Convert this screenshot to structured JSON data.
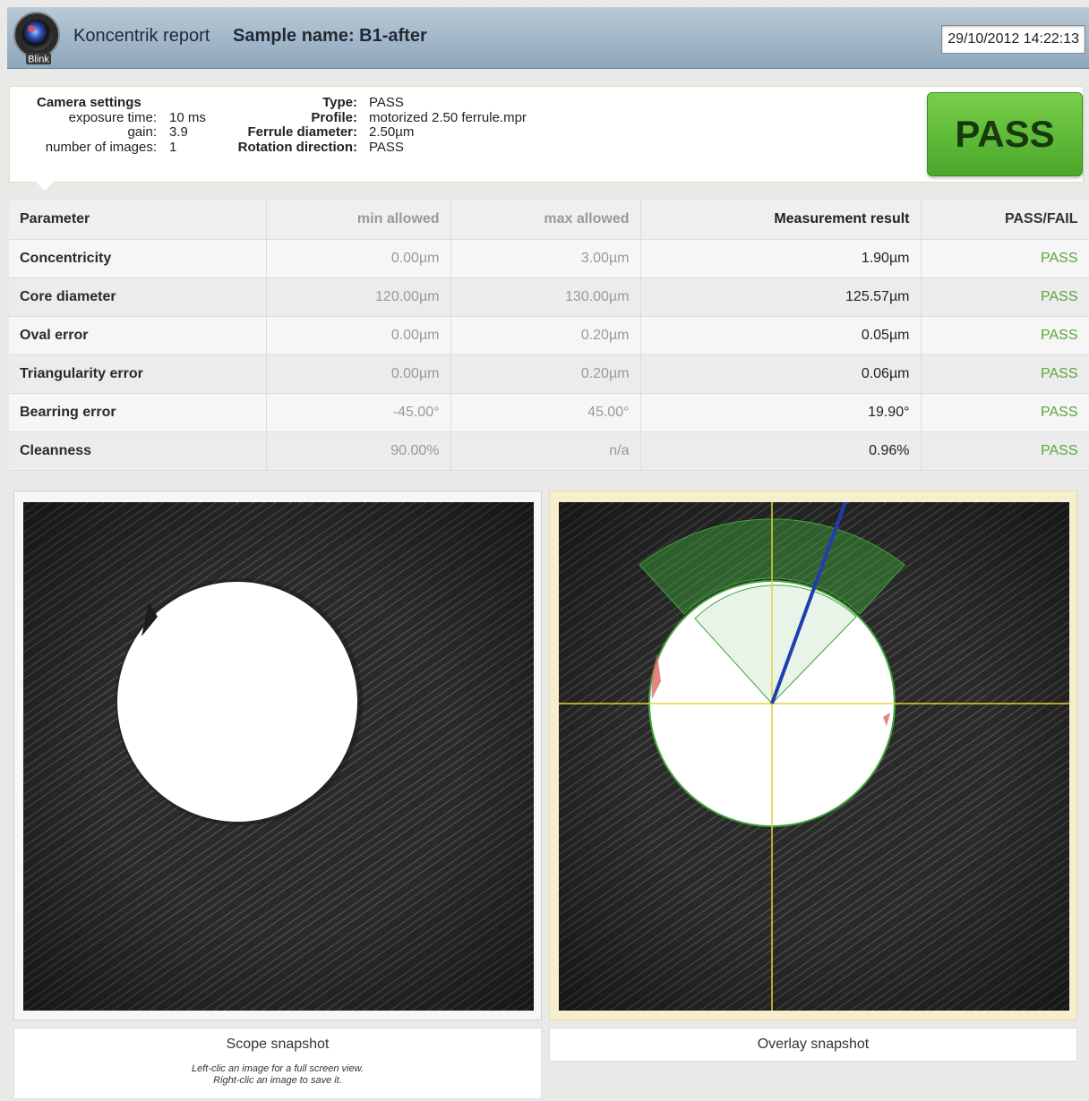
{
  "header": {
    "logo_text": "Blink",
    "app_title": "Koncentrik report",
    "sample_name": "Sample name: B1-after",
    "timestamp": "29/10/2012 14:22:13"
  },
  "camera_settings": {
    "title": "Camera settings",
    "rows": [
      {
        "label": "exposure time:",
        "value": "10 ms"
      },
      {
        "label": "gain:",
        "value": "3.9"
      },
      {
        "label": "number of images:",
        "value": "1"
      }
    ]
  },
  "profile_info": {
    "rows": [
      {
        "label": "Type:",
        "value": "PASS"
      },
      {
        "label": "Profile:",
        "value": "motorized 2.50 ferrule.mpr"
      },
      {
        "label": "Ferrule diameter:",
        "value": "2.50µm"
      },
      {
        "label": "Rotation direction:",
        "value": "PASS"
      }
    ]
  },
  "overall_result": "PASS",
  "colors": {
    "pass_text": "#5aa53b",
    "badge_green": "#5bb836",
    "overlay_green": "#3fa63a",
    "axis_yellow": "#e6d23a",
    "bearing_blue": "#1f3fb0"
  },
  "table": {
    "headers": [
      "Parameter",
      "min allowed",
      "max allowed",
      "Measurement result",
      "PASS/FAIL"
    ],
    "rows": [
      [
        "Concentricity",
        "0.00µm",
        "3.00µm",
        "1.90µm",
        "PASS"
      ],
      [
        "Core diameter",
        "120.00µm",
        "130.00µm",
        "125.57µm",
        "PASS"
      ],
      [
        "Oval error",
        "0.00µm",
        "0.20µm",
        "0.05µm",
        "PASS"
      ],
      [
        "Triangularity error",
        "0.00µm",
        "0.20µm",
        "0.06µm",
        "PASS"
      ],
      [
        "Bearring error",
        "-45.00°",
        "45.00°",
        "19.90°",
        "PASS"
      ],
      [
        "Cleanness",
        "90.00%",
        "n/a",
        "0.96%",
        "PASS"
      ]
    ]
  },
  "snapshots": {
    "scope": {
      "caption": "Scope snapshot",
      "hint_line1": "Left-clic an image for a full screen view.",
      "hint_line2": "Right-clic an image to save it."
    },
    "overlay": {
      "caption": "Overlay snapshot"
    }
  }
}
